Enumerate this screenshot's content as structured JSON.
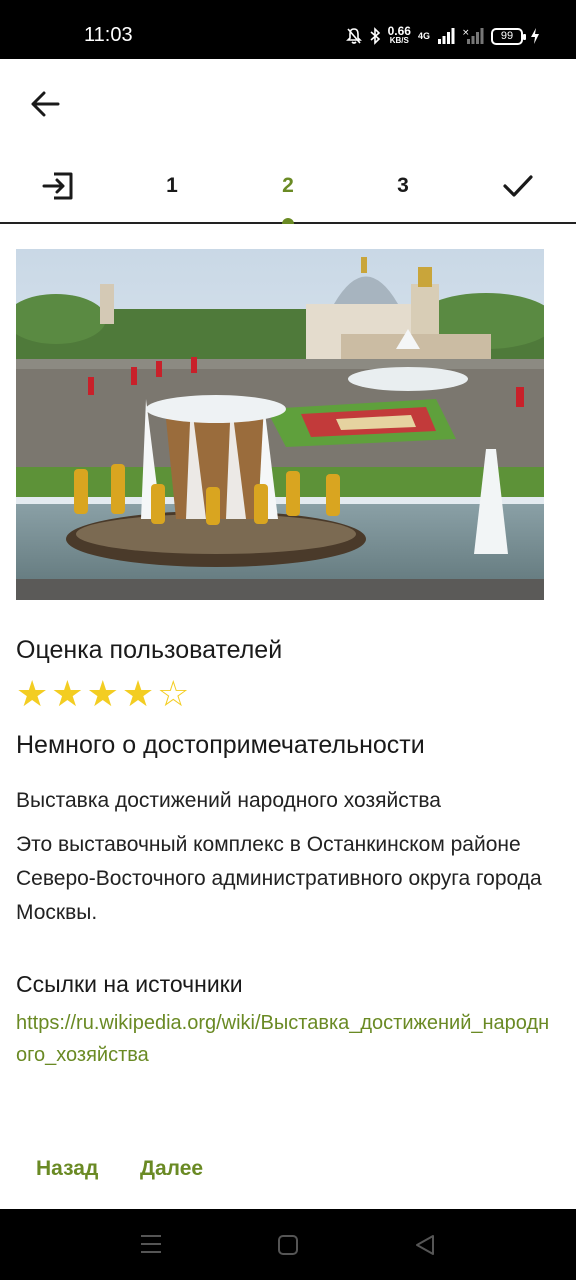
{
  "status_bar": {
    "time": "11:03",
    "net_speed_value": "0.66",
    "net_speed_unit": "KB/S",
    "network_type": "4G",
    "battery": "99"
  },
  "steps": {
    "items": [
      "1",
      "2",
      "3"
    ],
    "active_index": 1
  },
  "rating": {
    "heading": "Оценка пользователей",
    "value": 4,
    "max": 5,
    "color": "#f3cd22"
  },
  "about": {
    "heading": "Немного о достопримечательности",
    "name": "Выставка достижений народного хозяйства",
    "description": "Это выставочный комплекс в Останкинском районе Северо-Восточного административного округа города Москвы."
  },
  "sources": {
    "heading": "Ссылки на источники",
    "link": "https://ru.wikipedia.org/wiki/Выставка_достижений_народного_хозяйства"
  },
  "footer": {
    "back_label": "Назад",
    "next_label": "Далее"
  },
  "colors": {
    "accent": "#6a8a24"
  }
}
